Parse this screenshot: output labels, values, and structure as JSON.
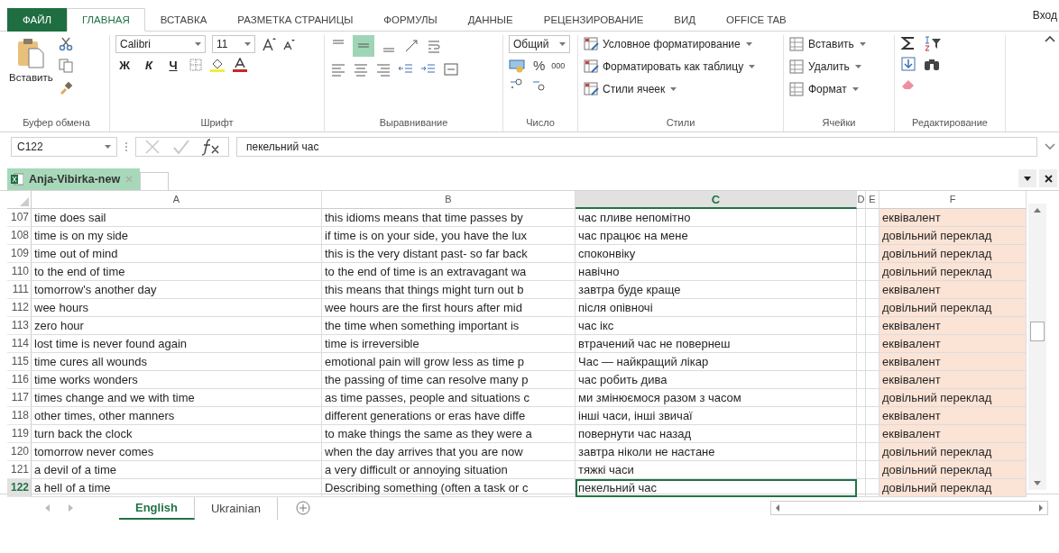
{
  "ribbon_tabs": [
    {
      "label": "ФАЙЛ",
      "kind": "file",
      "selected": false
    },
    {
      "label": "ГЛАВНАЯ",
      "kind": "tab",
      "selected": true
    },
    {
      "label": "ВСТАВКА",
      "kind": "tab",
      "selected": false
    },
    {
      "label": "РАЗМЕТКА СТРАНИЦЫ",
      "kind": "tab",
      "selected": false
    },
    {
      "label": "ФОРМУЛЫ",
      "kind": "tab",
      "selected": false
    },
    {
      "label": "ДАННЫЕ",
      "kind": "tab",
      "selected": false
    },
    {
      "label": "РЕЦЕНЗИРОВАНИЕ",
      "kind": "tab",
      "selected": false
    },
    {
      "label": "ВИД",
      "kind": "tab",
      "selected": false
    },
    {
      "label": "OFFICE TAB",
      "kind": "tab",
      "selected": false
    }
  ],
  "sign_in": "Вход",
  "ribbon": {
    "clipboard": {
      "paste": "Вставить",
      "label": "Буфер обмена"
    },
    "font": {
      "font_name": "Calibri",
      "font_size": "11",
      "bold": "Ж",
      "italic": "К",
      "underline": "Ч",
      "label": "Шрифт"
    },
    "alignment": {
      "label": "Выравнивание"
    },
    "number": {
      "format": "Общий",
      "percent": "%",
      "thousands": "000",
      "label": "Число"
    },
    "styles": {
      "items": [
        "Условное форматирование",
        "Форматировать как таблицу",
        "Стили ячеек"
      ],
      "label": "Стили"
    },
    "cells": {
      "items": [
        "Вставить",
        "Удалить",
        "Формат"
      ],
      "label": "Ячейки"
    },
    "editing": {
      "label": "Редактирование"
    }
  },
  "formula_bar": {
    "name_box": "C122",
    "formula": "пекельний час"
  },
  "workbook_tab": "Anja-Vibirka-new",
  "columns": [
    {
      "label": "A",
      "selected": false
    },
    {
      "label": "B",
      "selected": false
    },
    {
      "label": "C",
      "selected": true
    },
    {
      "label": "D",
      "selected": false
    },
    {
      "label": "E",
      "selected": false
    },
    {
      "label": "F",
      "selected": false
    }
  ],
  "rows": [
    {
      "number": "107",
      "selected": false,
      "cells": [
        "time does sail",
        "this idioms means that time passes by",
        "час пливе непомітно",
        "еквівалент"
      ]
    },
    {
      "number": "108",
      "selected": false,
      "cells": [
        "time is on my side",
        "if time is on your side, you have the lux",
        "час працює на мене",
        "довільний переклад"
      ]
    },
    {
      "number": "109",
      "selected": false,
      "cells": [
        "time out of mind",
        "this is the very distant past- so far back",
        "споконвіку",
        "довільний переклад"
      ]
    },
    {
      "number": "110",
      "selected": false,
      "cells": [
        "to the end of time",
        "to the end of time is an extravagant wa",
        "навічно",
        "довільний переклад"
      ]
    },
    {
      "number": "111",
      "selected": false,
      "cells": [
        "tomorrow's another day",
        "this means that things might turn out b",
        "завтра буде краще",
        "еквівалент"
      ]
    },
    {
      "number": "112",
      "selected": false,
      "cells": [
        "wee hours",
        "wee hours are the first hours after mid",
        "після опівночі",
        "довільний переклад"
      ]
    },
    {
      "number": "113",
      "selected": false,
      "cells": [
        "zero hour",
        "the time when something important is",
        "час ікс",
        "еквівалент"
      ]
    },
    {
      "number": "114",
      "selected": false,
      "cells": [
        "lost time is never found again",
        "time is irreversible",
        "втрачений час не повернеш",
        "еквівалент"
      ]
    },
    {
      "number": "115",
      "selected": false,
      "cells": [
        "time cures all wounds",
        "emotional pain will grow less as time p",
        "Час — найкращий лікар",
        "еквівалент"
      ]
    },
    {
      "number": "116",
      "selected": false,
      "cells": [
        "time works wonders",
        "the passing of time can resolve many p",
        "час робить дива",
        "еквівалент"
      ]
    },
    {
      "number": "117",
      "selected": false,
      "cells": [
        "times change and we with time",
        "as time passes, people and situations c",
        "ми змінюємося разом з часом",
        "довільний переклад"
      ]
    },
    {
      "number": "118",
      "selected": false,
      "cells": [
        "other times, other manners",
        "different generations or eras have diffe",
        "інші часи, інші звичаї",
        "еквівалент"
      ]
    },
    {
      "number": "119",
      "selected": false,
      "cells": [
        "turn back the clock",
        "to make things the same as they were a",
        "повернути час назад",
        "еквівалент"
      ]
    },
    {
      "number": "120",
      "selected": false,
      "cells": [
        "tomorrow never comes",
        "when the day arrives that you are now",
        "завтра ніколи не настане",
        "довільний переклад"
      ]
    },
    {
      "number": "121",
      "selected": false,
      "cells": [
        "a devil of a time",
        "a very difficult or annoying situation",
        "тяжкі часи",
        "довільний переклад"
      ]
    },
    {
      "number": "122",
      "selected": true,
      "cells": [
        "a hell of a time",
        "Describing something (often a task or c",
        "пекельний час",
        "довільний переклад"
      ]
    }
  ],
  "sheet_tabs": [
    {
      "label": "English",
      "selected": true
    },
    {
      "label": "Ukrainian",
      "selected": false
    }
  ]
}
